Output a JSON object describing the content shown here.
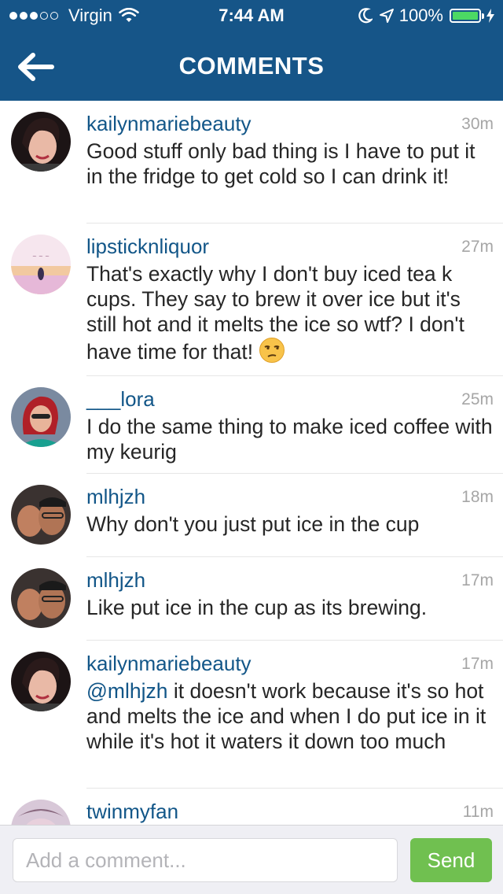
{
  "status_bar": {
    "carrier": "Virgin",
    "time": "7:44 AM",
    "battery": "100%",
    "signal_bars_filled": 3,
    "signal_bars_total": 5,
    "battery_level": 1.0
  },
  "nav": {
    "title": "COMMENTS",
    "back_icon": "arrow-left-icon"
  },
  "comments": [
    {
      "user": "kailynmariebeauty",
      "time": "30m",
      "mention": "",
      "text": "Good stuff only bad thing is I have to put it in the fridge to get cold so I can drink it!"
    },
    {
      "user": "lipsticknliquor",
      "time": "27m",
      "mention": "",
      "text": "That's exactly why I don't buy iced tea k cups. They say to brew it over ice but it's still hot and it melts the ice so wtf? I don't have time for that!"
    },
    {
      "user": "___lora",
      "time": "25m",
      "mention": "",
      "text": "I do the same thing to make iced coffee with my keurig"
    },
    {
      "user": "mlhjzh",
      "time": "18m",
      "mention": "",
      "text": "Why don't you just put ice in the cup"
    },
    {
      "user": "mlhjzh",
      "time": "17m",
      "mention": "",
      "text": "Like put ice in the cup as its brewing."
    },
    {
      "user": "kailynmariebeauty",
      "time": "17m",
      "mention": "@mlhjzh",
      "text": " it doesn't work because it's so hot and melts the ice and when I do put ice in it while it's hot it waters it down too much"
    },
    {
      "user": "twinmyfan",
      "time": "11m",
      "mention": "",
      "text": ""
    }
  ],
  "comment_box": {
    "placeholder": "Add a comment...",
    "send_label": "Send"
  },
  "colors": {
    "header": "#165588",
    "username": "#125688",
    "send_button": "#70c050",
    "footer": "#efeff4"
  }
}
